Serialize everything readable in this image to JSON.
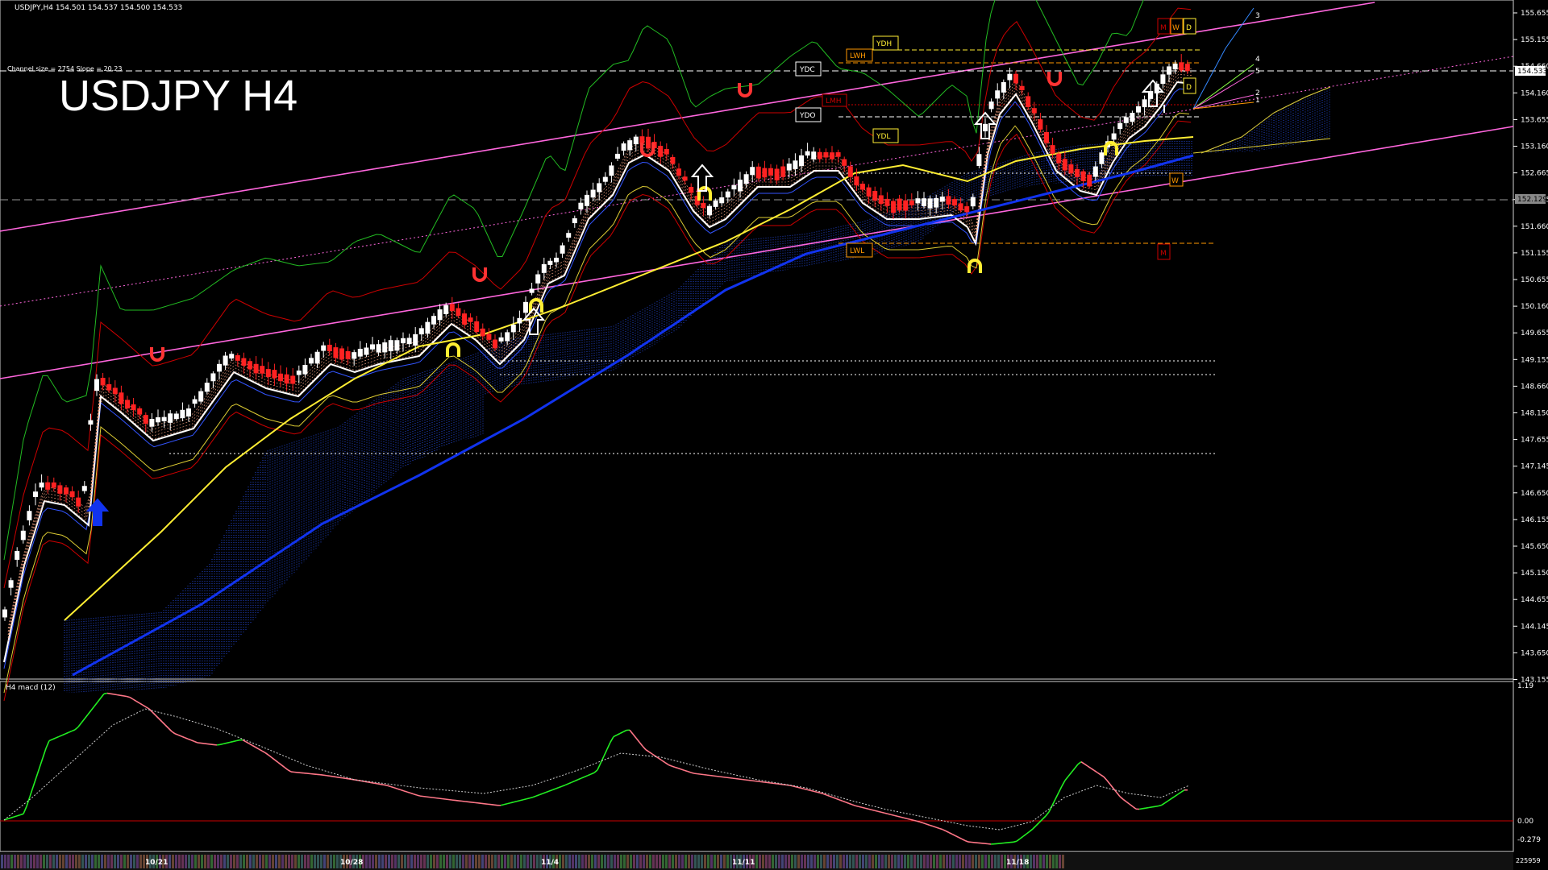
{
  "header": {
    "symbol_info": "USDJPY,H4  154.501 154.537 154.500 154.533",
    "channel_info": "Channel size = 2754 Slope = 20.23",
    "big_title": "USDJPY H4"
  },
  "price_axis": {
    "ticks": [
      "155.655",
      "155.155",
      "154.660",
      "154.160",
      "153.655",
      "153.160",
      "152.665",
      "152.165",
      "151.660",
      "151.155",
      "150.655",
      "150.160",
      "149.655",
      "149.155",
      "148.660",
      "148.150",
      "147.655",
      "147.145",
      "146.650",
      "146.155",
      "145.650",
      "145.150",
      "144.655",
      "144.145",
      "143.650",
      "143.155"
    ],
    "current_price": "154.533",
    "marked_price": "152.129"
  },
  "macd": {
    "label": "H4 macd (12)",
    "ticks": [
      "1.19",
      "0.00",
      "-0.279"
    ]
  },
  "date_axis": {
    "labels": [
      "10/21",
      "10/28",
      "11/4",
      "11/11",
      "11/18"
    ],
    "volume_value": "225959"
  },
  "level_labels": {
    "ydh": "YDH",
    "ydc": "YDC",
    "ydo": "YDO",
    "ydl": "YDL",
    "lwh": "LWH",
    "lwl": "LWL",
    "lmh": "LMH",
    "m_top": "M",
    "w_top": "W",
    "d_top": "D",
    "d_mid": "D",
    "w_mid": "W",
    "m_bot": "M"
  },
  "fan_labels": [
    "3",
    "4",
    "5",
    "2",
    "1"
  ],
  "colors": {
    "background": "#000000",
    "channel": "#ff66dd",
    "bollinger": "#cc0000",
    "envelope_green": "#22bb22",
    "ema_white": "#ffffff",
    "ema_yellow": "#ffee33",
    "ema_blue": "#1133ee",
    "cloud": "#2244cc",
    "macd_up": "#22ee22",
    "macd_down": "#ff7788",
    "bull_candle": "#ffffff",
    "bear_candle": "#ff2222"
  }
}
